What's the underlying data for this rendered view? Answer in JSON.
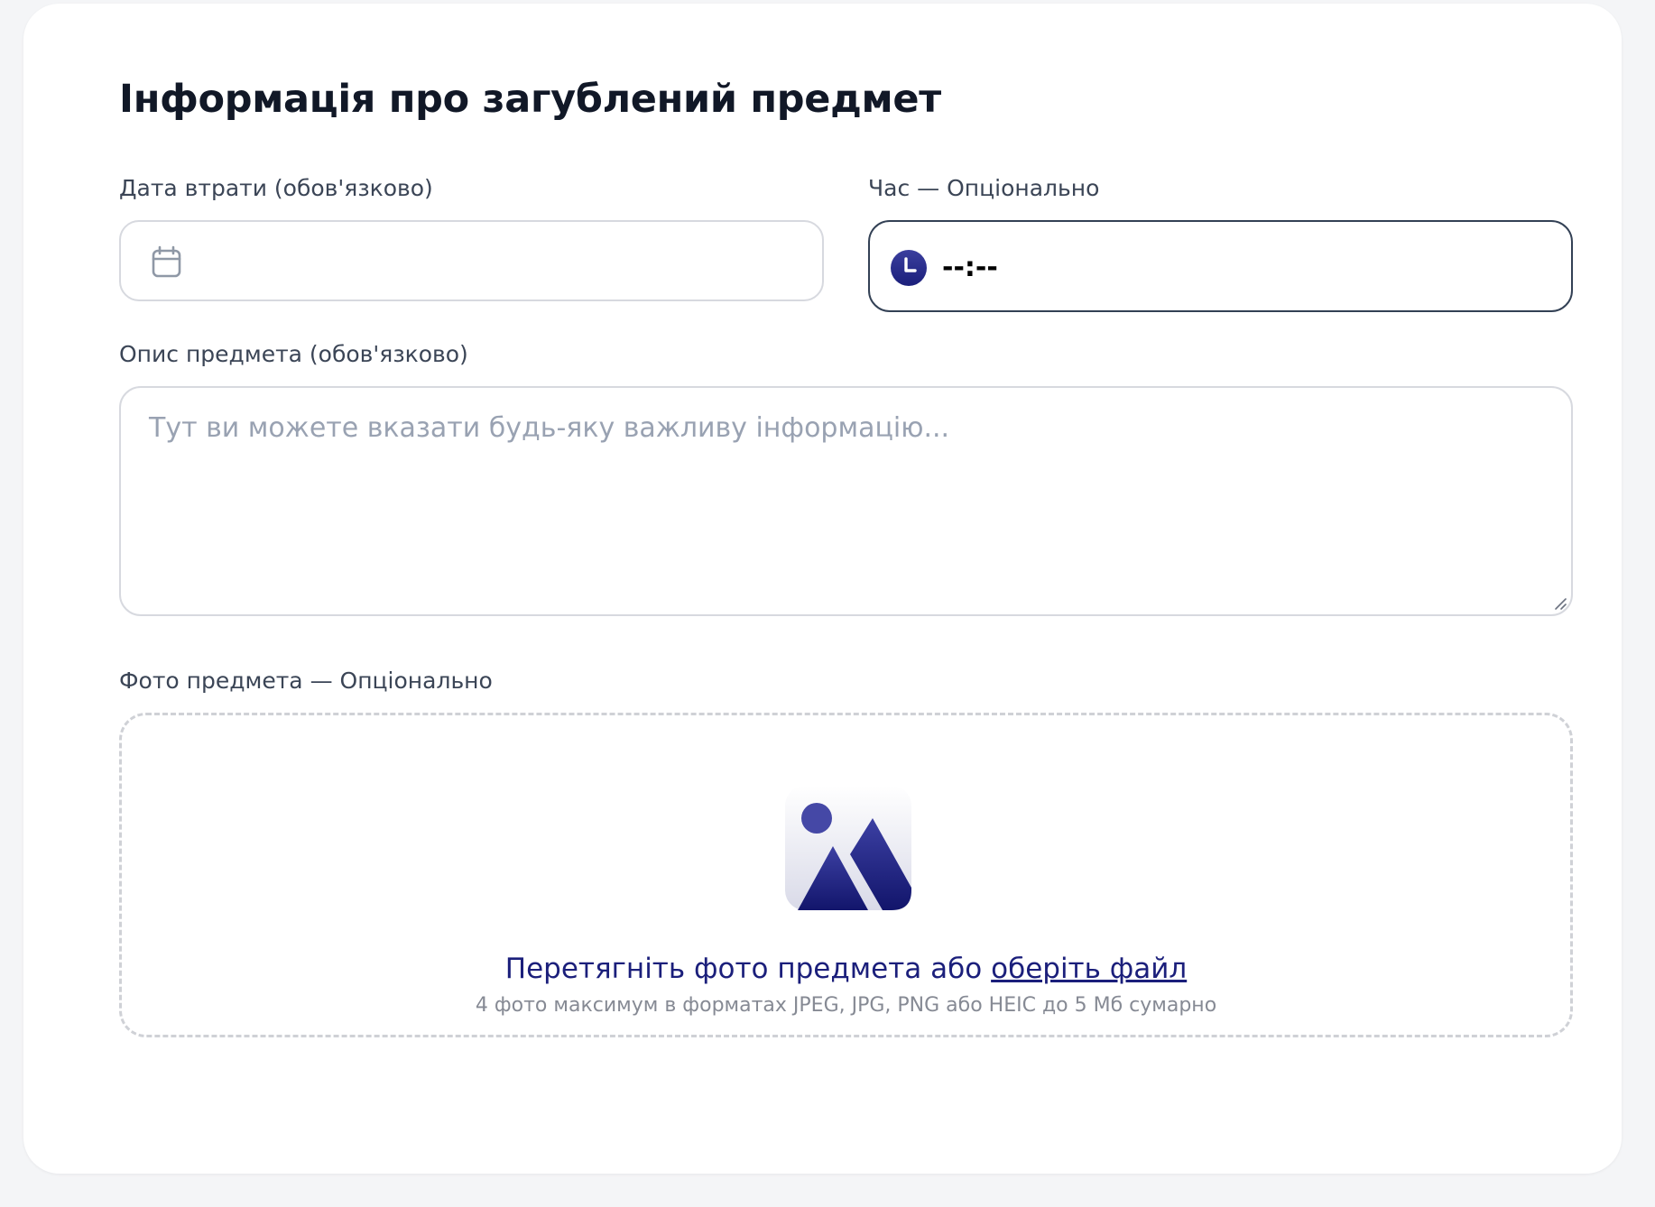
{
  "section": {
    "title": "Інформація про загублений предмет"
  },
  "date": {
    "label": "Дата втрати (обов'язково)",
    "value": "",
    "icon": "calendar-icon"
  },
  "time": {
    "label": "Час — Опціонально",
    "value": "--:--",
    "icon": "clock-icon"
  },
  "description": {
    "label": "Опис предмета (обов'язково)",
    "placeholder": "Тут ви можете вказати будь-яку важливу інформацію..."
  },
  "photo": {
    "label": "Фото предмета — Опціонально",
    "icon": "image-icon",
    "drag_text": "Перетягніть фото предмета або",
    "choose_link": "оберіть файл",
    "hint": "4 фото максимум в форматах JPEG, JPG, PNG або HEIC до 5 Мб сумарно"
  },
  "colors": {
    "accent": "#1b1f7b",
    "border": "#d7d9df",
    "focused_border": "#334155"
  }
}
